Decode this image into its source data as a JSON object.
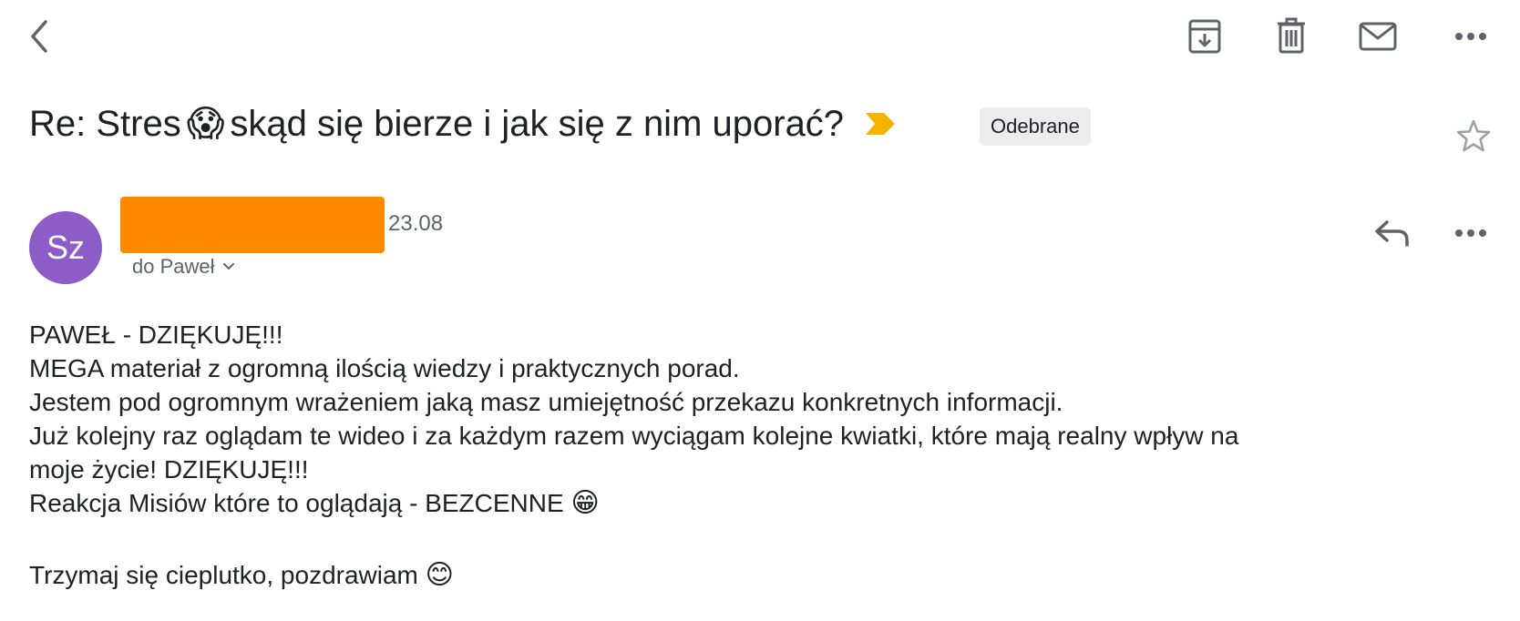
{
  "toolbar": {
    "back_icon": "chevron-left-icon",
    "archive_icon": "archive-icon",
    "delete_icon": "trash-icon",
    "mark_unread_icon": "mail-icon",
    "more_icon": "more-horizontal-icon"
  },
  "subject": {
    "prefix": "Re: Stres",
    "emoji": "😱",
    "rest": "skąd się bierze i jak się z nim uporać?",
    "importance_marker": "label-arrow-icon",
    "label": "Odebrane",
    "star_icon": "star-outline-icon"
  },
  "message": {
    "avatar_initials": "Sz",
    "date": "23.08",
    "recipient": "do Paweł",
    "reply_icon": "reply-icon",
    "more_icon": "more-horizontal-icon",
    "lines": [
      "PAWEŁ - DZIĘKUJĘ!!!",
      "MEGA materiał z ogromną ilością wiedzy i praktycznych porad.",
      "Jestem pod ogromnym wrażeniem jaką masz umiejętność przekazu konkretnych informacji.",
      "Już kolejny raz oglądam te wideo i za każdym razem wyciągam kolejne kwiatki, które mają realny wpływ na",
      "moje życie! DZIĘKUJĘ!!!",
      "Reakcja Misiów które to oglądają - BEZCENNE"
    ],
    "line6_emoji": "😁",
    "closing": "Trzymaj się cieplutko, pozdrawiam",
    "closing_emoji": "😊"
  },
  "colors": {
    "avatar": "#8e5cc7",
    "redaction": "#ff8a00",
    "importance_marker": "#f4b400",
    "label_bg": "#ececec"
  }
}
